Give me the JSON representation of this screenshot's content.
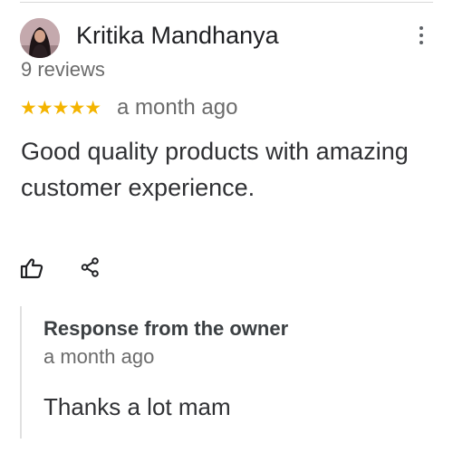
{
  "review": {
    "author_name": "Kritika Mandhanya",
    "review_count": "9 reviews",
    "rating": 5,
    "stars": "★★★★★",
    "time": "a month ago",
    "text": "Good quality products with amazing customer experience."
  },
  "response": {
    "title": "Response from the owner",
    "time": "a month ago",
    "text": "Thanks a lot mam"
  },
  "icons": {
    "avatar": "avatar-photo",
    "more": "more-vert-icon",
    "like": "thumbs-up-icon",
    "share": "share-icon"
  },
  "colors": {
    "star": "#f4b400",
    "primary_text": "#202124",
    "secondary_text": "#6b6b6b"
  }
}
